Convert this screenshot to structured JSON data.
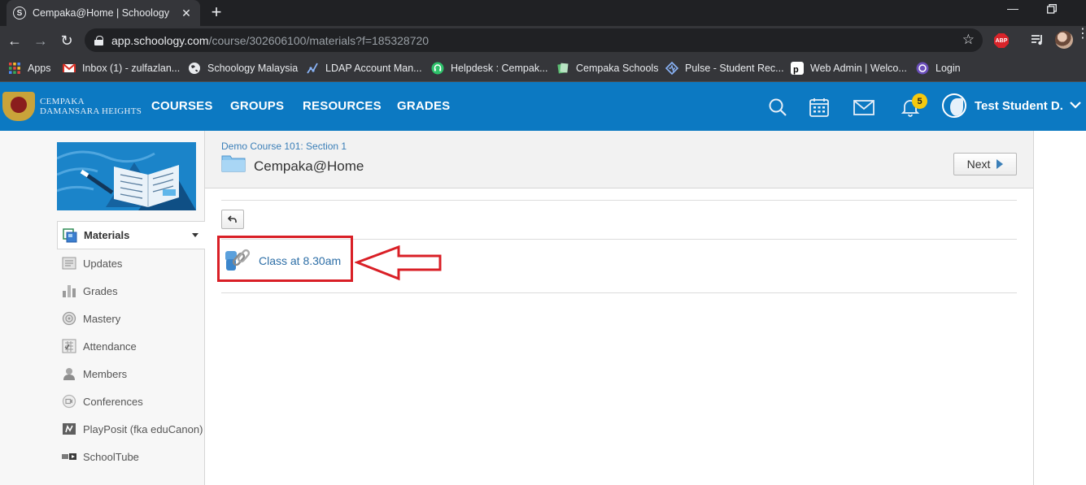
{
  "browser": {
    "tab_title": "Cempaka@Home | Schoology",
    "tab_favicon": "S",
    "new_tab": "+",
    "url_host": "app.schoology.com",
    "url_path": "/course/302606100/materials?f=185328720",
    "abp_label": "ABP",
    "bookmarks": [
      {
        "label": "Apps",
        "icon": "apps-grid-icon"
      },
      {
        "label": "Inbox (1) - zulfazlan...",
        "icon": "gmail-icon"
      },
      {
        "label": "Schoology Malaysia",
        "icon": "globe-icon"
      },
      {
        "label": "LDAP Account Man...",
        "icon": "ldap-icon"
      },
      {
        "label": "Helpdesk : Cempak...",
        "icon": "helpdesk-icon"
      },
      {
        "label": "Cempaka Schools",
        "icon": "cempaka-schools-icon"
      },
      {
        "label": "Pulse - Student Rec...",
        "icon": "pulse-icon"
      },
      {
        "label": "Web Admin | Welco...",
        "icon": "webadmin-icon"
      },
      {
        "label": "Login",
        "icon": "login-icon"
      }
    ]
  },
  "header": {
    "logo_line1": "CEMPAKA",
    "logo_line2": "DAMANSARA HEIGHTS",
    "nav": [
      "COURSES",
      "GROUPS",
      "RESOURCES",
      "GRADES"
    ],
    "notification_count": "5",
    "user_name": "Test Student D."
  },
  "sidebar": {
    "items": [
      {
        "label": "Materials",
        "icon": "materials-icon",
        "active": true
      },
      {
        "label": "Updates",
        "icon": "updates-icon"
      },
      {
        "label": "Grades",
        "icon": "grades-icon"
      },
      {
        "label": "Mastery",
        "icon": "mastery-icon"
      },
      {
        "label": "Attendance",
        "icon": "attendance-icon"
      },
      {
        "label": "Members",
        "icon": "members-icon"
      },
      {
        "label": "Conferences",
        "icon": "conferences-icon"
      },
      {
        "label": "PlayPosit (fka eduCanon)",
        "icon": "playposit-icon"
      },
      {
        "label": "SchoolTube",
        "icon": "schooltube-icon"
      }
    ]
  },
  "main": {
    "breadcrumb": "Demo Course 101: Section 1",
    "title": "Cempaka@Home",
    "next_label": "Next",
    "material_link": "Class at 8.30am"
  },
  "colors": {
    "header_blue": "#0c79c2",
    "link_blue": "#2e6fa7",
    "annotation_red": "#d91f26",
    "badge_yellow": "#f6c90e"
  }
}
